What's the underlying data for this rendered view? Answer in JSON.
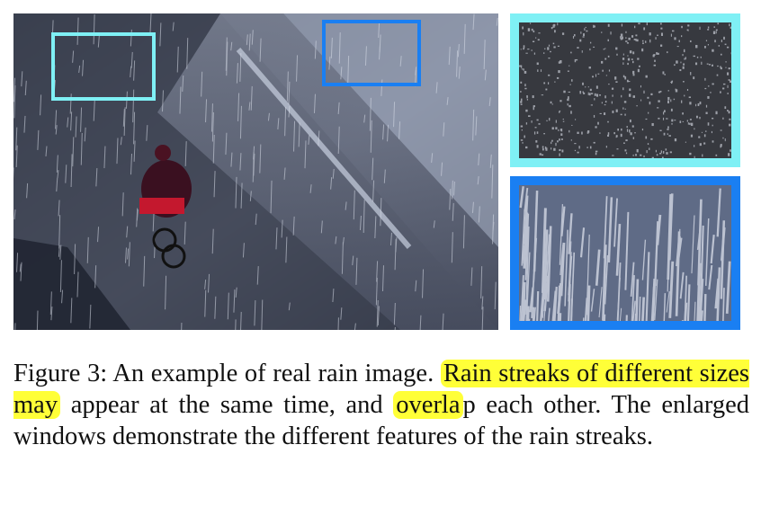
{
  "colors": {
    "highlight": "#ffff38",
    "window_light_cyan": "#7ff0f5",
    "window_blue": "#1a7ff2"
  },
  "figure": {
    "main_image_desc_icon": "rain-photo",
    "caption": {
      "part1": "Figure 3: An example of real rain image. ",
      "highlight1": "Rain streaks of different sizes may",
      "part2": " appear at the same time, and ",
      "highlight2": "overla",
      "part3": "p each other. The enlarged windows demonstrate the different features of the rain streaks."
    }
  }
}
